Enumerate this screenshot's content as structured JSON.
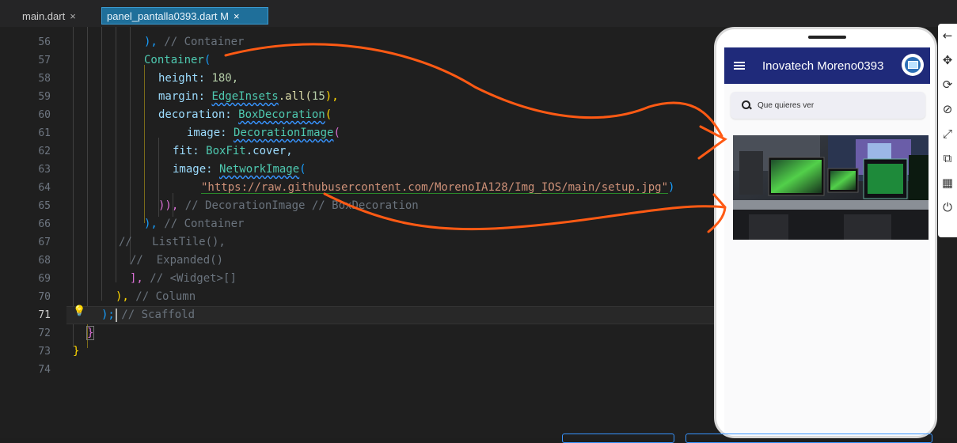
{
  "tabs": [
    {
      "label": "main.dart",
      "close": "×"
    },
    {
      "label": "panel_pantalla0393.dart M",
      "close": "×"
    }
  ],
  "editor": {
    "active_line": 71,
    "lines": [
      {
        "n": "56"
      },
      {
        "n": "57"
      },
      {
        "n": "58"
      },
      {
        "n": "59"
      },
      {
        "n": "60"
      },
      {
        "n": "61"
      },
      {
        "n": "62"
      },
      {
        "n": "63"
      },
      {
        "n": "64"
      },
      {
        "n": "65"
      },
      {
        "n": "66"
      },
      {
        "n": "67"
      },
      {
        "n": "68"
      },
      {
        "n": "69"
      },
      {
        "n": "70"
      },
      {
        "n": "71"
      },
      {
        "n": "72"
      },
      {
        "n": "73"
      },
      {
        "n": "74"
      }
    ],
    "code": {
      "l56_close": "),",
      "l56_comment": "// Container",
      "l57_cls": "Container",
      "l57_paren": "(",
      "l58_prop": "height:",
      "l58_val": "180,",
      "l59_prop": "margin:",
      "l59_cls": "EdgeInsets",
      "l59_rest": ".all(",
      "l59_num": "15",
      "l59_end": "),",
      "l60_prop": "decoration:",
      "l60_cls": "BoxDecoration",
      "l60_paren": "(",
      "l61_prop": "image:",
      "l61_cls": "DecorationImage",
      "l61_paren": "(",
      "l62_prop": "fit:",
      "l62_cls": "BoxFit",
      "l62_rest": ".cover,",
      "l63_prop": "image:",
      "l63_cls": "NetworkImage",
      "l63_paren": "(",
      "l64_str": "\"https://raw.githubusercontent.com/MorenoIA128/Img_IOS/main/setup.jpg\"",
      "l64_end": ")",
      "l65_close": ")),",
      "l65_comment": "// DecorationImage // BoxDecoration",
      "l66_close": "),",
      "l66_comment": "// Container",
      "l67_comment": "//   ListTile(),",
      "l68_comment": "//  Expanded()",
      "l69_close": "],",
      "l69_comment": "// <Widget>[]",
      "l70_close": "),",
      "l70_comment": "// Column",
      "l71_close": ");",
      "l71_comment": "// Scaffold",
      "l72_close": "}",
      "l73_close": "}"
    }
  },
  "phone": {
    "app_title": "Inovatech Moreno0393",
    "search_placeholder": "Que quieres ver"
  },
  "sidebar_icons": [
    "back-arrow-icon",
    "move-icon",
    "rotate-icon",
    "rotate-screen-icon",
    "resize-icon",
    "external-link-icon",
    "qr-code-icon",
    "power-icon"
  ],
  "sidebar_glyphs": [
    "←",
    "✥",
    "⟳",
    "⊘",
    "⤢",
    "⧉",
    "▦",
    "⏻"
  ],
  "colors": {
    "appbar": "#1f2a7a",
    "annotation": "#ff5a14",
    "active_tab": "#1f6f9a"
  }
}
